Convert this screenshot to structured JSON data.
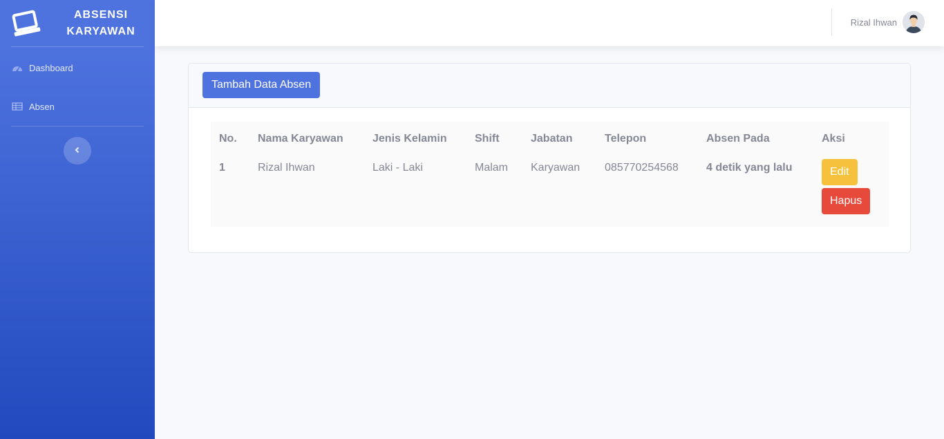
{
  "brand": {
    "line1": "ABSENSI",
    "line2": "KARYAWAN",
    "icon": "laptop-icon"
  },
  "sidebar": {
    "items": [
      {
        "label": "Dashboard",
        "icon": "tachometer-icon"
      },
      {
        "label": "Absen",
        "icon": "table-icon"
      }
    ],
    "toggle_icon": "chevron-left-icon"
  },
  "topbar": {
    "user_name": "Rizal Ihwan",
    "avatar": "user-avatar"
  },
  "card": {
    "add_button": "Tambah Data Absen",
    "table": {
      "headers": [
        "No.",
        "Nama Karyawan",
        "Jenis Kelamin",
        "Shift",
        "Jabatan",
        "Telepon",
        "Absen Pada",
        "Aksi"
      ],
      "rows": [
        {
          "no": "1",
          "nama": "Rizal Ihwan",
          "jenis_kelamin": "Laki - Laki",
          "shift": "Malam",
          "jabatan": "Karyawan",
          "telepon": "085770254568",
          "absen_pada": "4 detik yang lalu",
          "edit_label": "Edit",
          "hapus_label": "Hapus"
        }
      ]
    }
  },
  "colors": {
    "primary": "#4e73df",
    "warning": "#f6c23e",
    "danger": "#e74a3b",
    "text": "#858796"
  }
}
